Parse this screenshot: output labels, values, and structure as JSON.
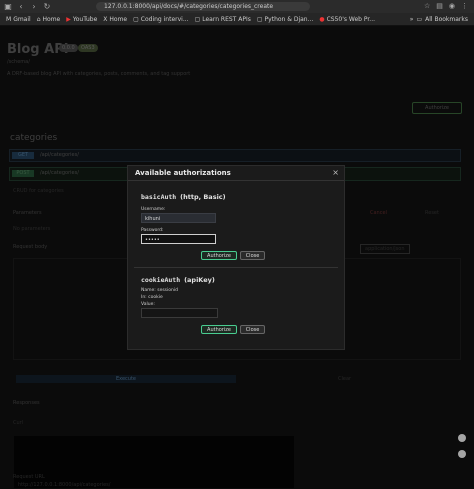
{
  "browser": {
    "url": "127.0.0.1:8000/api/docs/#/categories/categories_create",
    "bookmarks": [
      "Gmail",
      "Home",
      "YouTube",
      "Home",
      "Coding intervi...",
      "Learn REST APIs",
      "Python & Djan...",
      "CS50's Web Pr..."
    ],
    "all_bookmarks": "All Bookmarks"
  },
  "background": {
    "api_title": "Blog API",
    "badge_version": "0.0.0",
    "badge_oas": "OAS3",
    "schema_link": "/schema/",
    "description": "A DRF-based blog API with categories, posts, comments, and tag support",
    "authorize_label": "Authorize",
    "section_title": "categories",
    "op1_method": "GET",
    "op1_path": "/api/categories/",
    "op2_method": "POST",
    "op2_path": "/api/categories/",
    "op2_desc": "CRUD for categories",
    "parameters_label": "Parameters",
    "cancel_label": "Cancel",
    "reset_label": "Reset",
    "no_params": "No parameters",
    "request_body": "Request body",
    "content_type": "application/json",
    "execute_label": "Execute",
    "clear_label": "Clear",
    "responses_label": "Responses",
    "curl_label": "Curl",
    "request_url_label": "Request URL",
    "request_url": "http://127.0.0.1:8000/api/categories/"
  },
  "modal": {
    "title": "Available authorizations",
    "close_icon": "close-icon",
    "basic": {
      "name": "basicAuth",
      "type": "(http, Basic)",
      "username_label": "Username:",
      "username_value": "kihuni",
      "password_label": "Password:",
      "password_value": "•••••",
      "authorize_label": "Authorize",
      "close_label": "Close"
    },
    "cookie": {
      "name": "cookieAuth",
      "type": "(apiKey)",
      "name_line": "Name: sessionid",
      "in_line": "In: cookie",
      "value_label": "Value:",
      "authorize_label": "Authorize",
      "close_label": "Close"
    }
  }
}
